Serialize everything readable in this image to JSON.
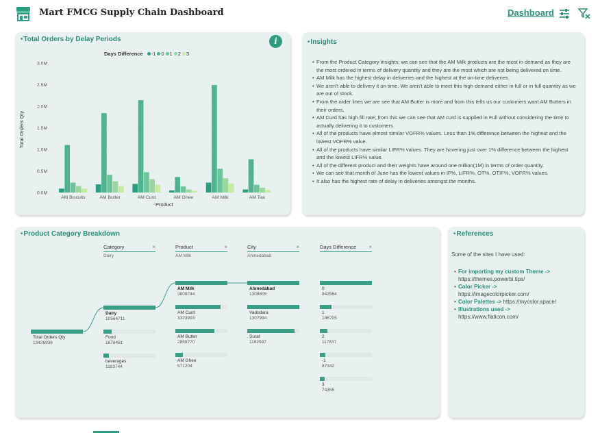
{
  "header": {
    "title": "Mart FMCG Supply Chain Dashboard",
    "dashboard_link": "Dashboard",
    "icons": [
      "store-icon",
      "sliders-icon",
      "filter-clear-icon"
    ]
  },
  "delay_card": {
    "title": "Total Orders by Delay Periods",
    "legend_title": "Days Difference",
    "info_icon": "i"
  },
  "chart_data": {
    "type": "bar",
    "title": "Total Orders by Delay Periods",
    "xlabel": "Product",
    "ylabel": "Total Orders Qty",
    "ylim": [
      0,
      3000000
    ],
    "yticks": [
      "0.0M",
      "0.5M",
      "1.0M",
      "1.5M",
      "2.0M",
      "2.5M",
      "3.0M"
    ],
    "legend_position": "top",
    "categories": [
      "AM Biscuits",
      "AM Butter",
      "AM Curd",
      "AM Ghee",
      "AM Milk",
      "AM Tea"
    ],
    "series": [
      {
        "name": "-1",
        "color": "#2b9d80",
        "values": [
          90000,
          190000,
          200000,
          50000,
          230000,
          70000
        ]
      },
      {
        "name": "0",
        "color": "#4fb38f",
        "values": [
          1100000,
          1840000,
          2140000,
          360000,
          2490000,
          770000
        ]
      },
      {
        "name": "1",
        "color": "#6cc59a",
        "values": [
          230000,
          410000,
          470000,
          140000,
          550000,
          180000
        ]
      },
      {
        "name": "2",
        "color": "#98d89f",
        "values": [
          150000,
          260000,
          310000,
          70000,
          330000,
          110000
        ]
      },
      {
        "name": "3",
        "color": "#c5eaa1",
        "values": [
          90000,
          150000,
          180000,
          40000,
          210000,
          60000
        ]
      }
    ]
  },
  "insights_card": {
    "title": "Insights",
    "items": [
      "From the Product Category insights, we can see that the AM Milk products are the most in demand as they are the most ordered in terms of delivery quantity and they are the most which are not being delivered on time.",
      "AM Milk has the highest delay in deliveries and the highest at the on-time deliveries.",
      "We aren't able to delivery it on time. We aren't able to meet this high demand either in full or in full quantity as we are out of stock.",
      " From the order lines we are see that AM Butter is more and from this tells us our customers want AM Butters in their orders.",
      "AM Curd has high fill rate; from this we can see that AM curd is supplied in Full without considering the time to actually delivering it to customers.",
      "All of the products have almost similar VOFR% values. Less than 1% difference between the highest and the lowest VOFR% value.",
      "All of the products have similar LIFR% values. They are hovering just over 1% difference between the highest and the lowest LIFR% value.",
      "All of the different product and their weights have around one million(1M) in terms of order quantity.",
      "We can see that month of June has the lowest values in IF%, LIFR%, OT%, OTIF%, VOFR% values.",
      "It also has the highest rate of delay in deliveries amongst the months."
    ]
  },
  "breakdown_card": {
    "title": "Product Category Breakdown",
    "headers": [
      {
        "title": "Category",
        "value": "Dairy"
      },
      {
        "title": "Product",
        "value": "AM Milk"
      },
      {
        "title": "City",
        "value": "Ahmedabad"
      },
      {
        "title": "Days Difference",
        "value": ""
      }
    ],
    "root": {
      "label": "Total Orders Qty",
      "value": "13426936",
      "fraction": 1.0
    },
    "category": [
      {
        "label": "Dairy",
        "value": "10564711",
        "fraction": 1.0,
        "selected": true
      },
      {
        "label": "Food",
        "value": "1678481",
        "fraction": 0.16
      },
      {
        "label": "beverages",
        "value": "1183744",
        "fraction": 0.11
      }
    ],
    "product": [
      {
        "label": "AM Milk",
        "value": "3809744",
        "fraction": 1.0,
        "selected": true
      },
      {
        "label": "AM Curd",
        "value": "3323993",
        "fraction": 0.87
      },
      {
        "label": "AM Butter",
        "value": "2859770",
        "fraction": 0.75
      },
      {
        "label": "AM Ghee",
        "value": "571204",
        "fraction": 0.15
      }
    ],
    "city": [
      {
        "label": "Ahmedabad",
        "value": "1308805",
        "fraction": 1.0,
        "selected": true
      },
      {
        "label": "Vadodara",
        "value": "1307994",
        "fraction": 1.0
      },
      {
        "label": "Surat",
        "value": "1192947",
        "fraction": 0.91
      }
    ],
    "days": [
      {
        "label": "0",
        "value": "842564",
        "fraction": 1.0
      },
      {
        "label": "1",
        "value": "186705",
        "fraction": 0.22
      },
      {
        "label": "2",
        "value": "117837",
        "fraction": 0.14
      },
      {
        "label": "-1",
        "value": "87342",
        "fraction": 0.1
      },
      {
        "label": "3",
        "value": "74355",
        "fraction": 0.09
      }
    ]
  },
  "references_card": {
    "title": "References",
    "intro": "Some of the sites I have used:",
    "items": [
      {
        "label": "For importing my custom Theme ->",
        "url": "https://themes.powerbi.tips/",
        "inline": false
      },
      {
        "label": "Color Picker ->",
        "url": "https://imagecolorpicker.com/",
        "inline": false
      },
      {
        "label": "Color Palettes ->",
        "url": "https://mycolor.space/",
        "inline": true
      },
      {
        "label": "Illustrations used ->",
        "url": "https://www.flaticon.com/",
        "inline": false
      }
    ]
  }
}
